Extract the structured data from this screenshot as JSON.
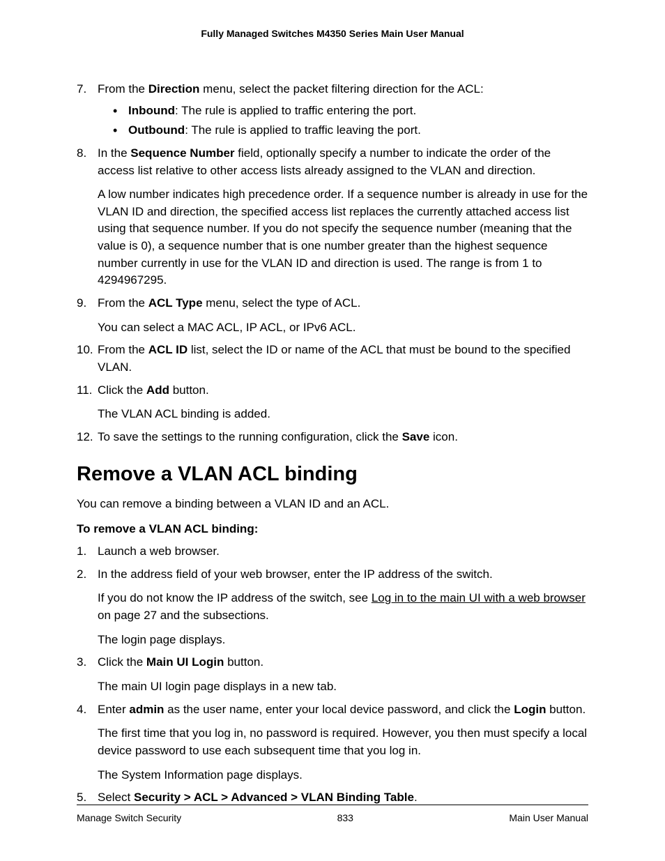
{
  "header": "Fully Managed Switches M4350 Series Main User Manual",
  "top_list": {
    "i7": {
      "num": "7.",
      "lead": "From the ",
      "bold1": "Direction",
      "trail": " menu, select the packet filtering direction for the ACL:",
      "bullets": [
        {
          "b": "Inbound",
          "t": ": The rule is applied to traffic entering the port."
        },
        {
          "b": "Outbound",
          "t": ": The rule is applied to traffic leaving the port."
        }
      ]
    },
    "i8": {
      "num": "8.",
      "p1a": "In the ",
      "p1b": "Sequence Number",
      "p1c": " field, optionally specify a number to indicate the order of the access list relative to other access lists already assigned to the VLAN and direction.",
      "p2": "A low number indicates high precedence order. If a sequence number is already in use for the VLAN ID and direction, the specified access list replaces the currently attached access list using that sequence number. If you do not specify the sequence number (meaning that the value is 0), a sequence number that is one number greater than the highest sequence number currently in use for the VLAN ID and direction is used. The range is from 1 to 4294967295."
    },
    "i9": {
      "num": "9.",
      "p1a": "From the ",
      "p1b": "ACL Type",
      "p1c": " menu, select the type of ACL.",
      "p2": "You can select a MAC ACL, IP ACL, or IPv6 ACL."
    },
    "i10": {
      "num": "10.",
      "p1a": "From the ",
      "p1b": "ACL ID",
      "p1c": " list, select the ID or name of the ACL that must be bound to the specified VLAN."
    },
    "i11": {
      "num": "11.",
      "p1a": "Click the ",
      "p1b": "Add",
      "p1c": " button.",
      "p2": "The VLAN ACL binding is added."
    },
    "i12": {
      "num": "12.",
      "p1a": "To save the settings to the running configuration, click the ",
      "p1b": "Save",
      "p1c": " icon."
    }
  },
  "section_title": "Remove a VLAN ACL binding",
  "intro": "You can remove a binding between a VLAN ID and an ACL.",
  "subhead": "To remove a VLAN ACL binding:",
  "steps": {
    "s1": {
      "num": "1.",
      "t": "Launch a web browser."
    },
    "s2": {
      "num": "2.",
      "p1": "In the address field of your web browser, enter the IP address of the switch.",
      "p2a": "If you do not know the IP address of the switch, see ",
      "link": "Log in to the main UI with a web browser",
      "p2b": " on page 27 and the subsections.",
      "p3": "The login page displays."
    },
    "s3": {
      "num": "3.",
      "p1a": "Click the ",
      "p1b": "Main UI Login",
      "p1c": " button.",
      "p2": "The main UI login page displays in a new tab."
    },
    "s4": {
      "num": "4.",
      "p1a": "Enter ",
      "p1b": "admin",
      "p1c": " as the user name, enter your local device password, and click the ",
      "p1d": "Login",
      "p1e": " button.",
      "p2": "The first time that you log in, no password is required. However, you then must specify a local device password to use each subsequent time that you log in.",
      "p3": "The System Information page displays."
    },
    "s5": {
      "num": "5.",
      "p1a": "Select ",
      "p1b": "Security > ACL > Advanced > VLAN Binding Table",
      "p1c": "."
    }
  },
  "footer": {
    "left": "Manage Switch Security",
    "center": "833",
    "right": "Main User Manual"
  }
}
